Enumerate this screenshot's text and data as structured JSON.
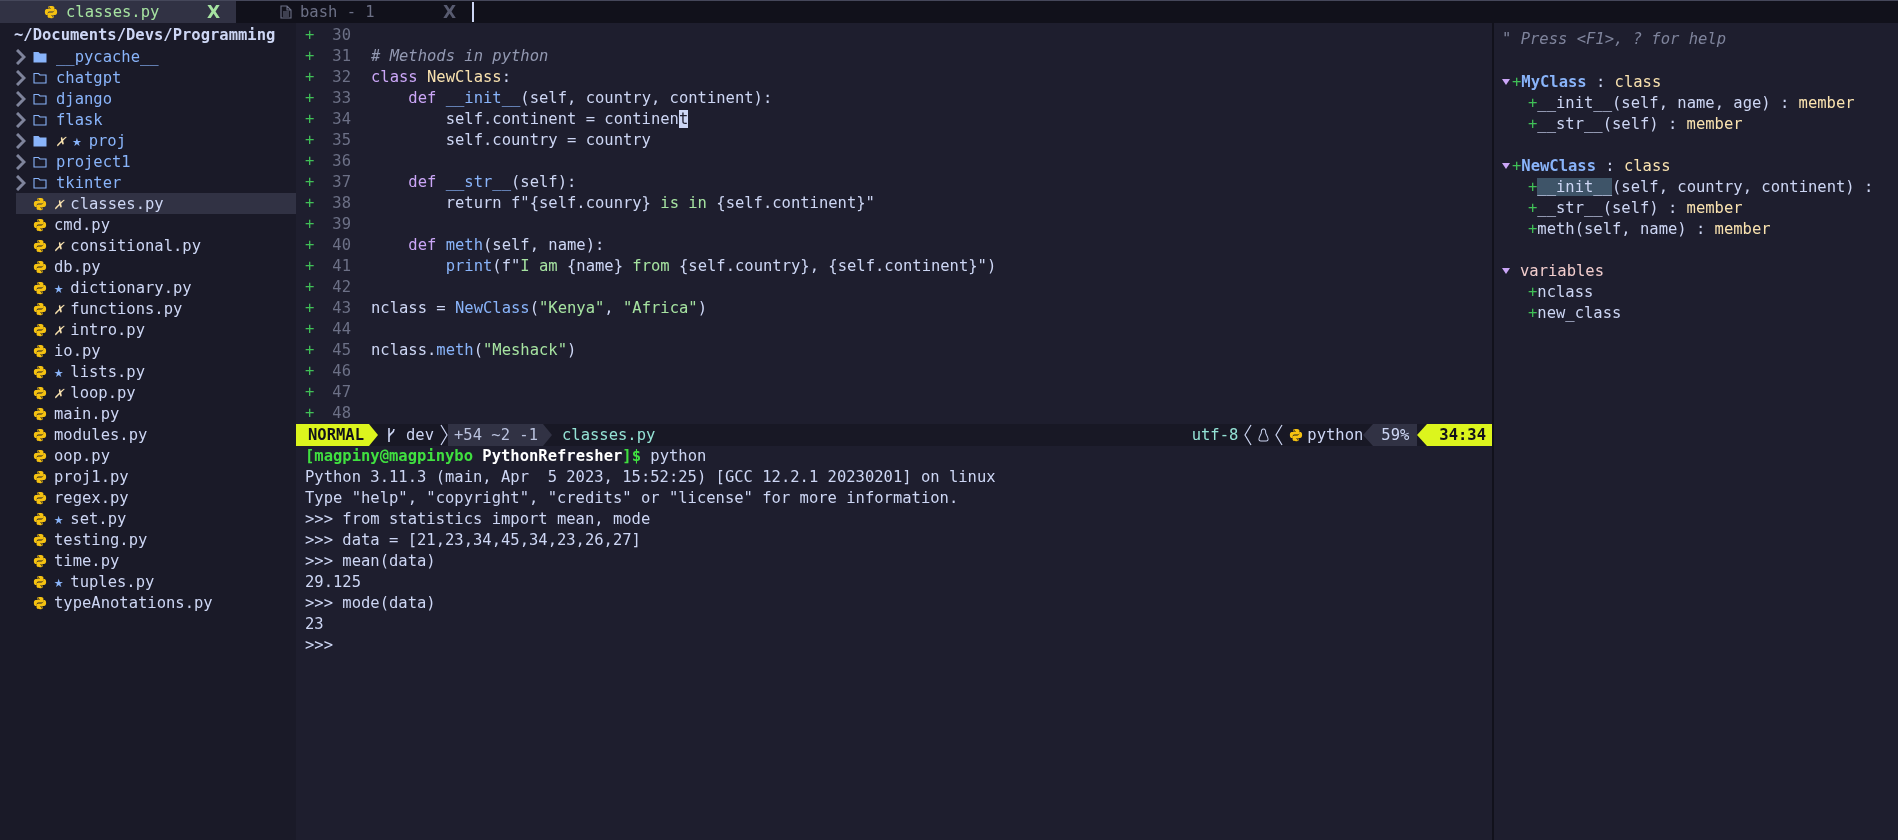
{
  "tabs": [
    {
      "kind": "python",
      "label": "classes.py",
      "close": "X",
      "selected": true
    },
    {
      "kind": "document",
      "label": "bash - 1",
      "close": "X",
      "selected": false
    }
  ],
  "sidebar": {
    "path": "~/Documents/Devs/Programming",
    "items": [
      {
        "kind": "folder_solid",
        "name": "__pycache__",
        "selected": false
      },
      {
        "kind": "folder",
        "name": "chatgpt",
        "selected": false
      },
      {
        "kind": "folder",
        "name": "django",
        "selected": false
      },
      {
        "kind": "folder",
        "name": "flask",
        "selected": false
      },
      {
        "kind": "folder_solid",
        "name": "proj",
        "flags": [
          {
            "kind": "modified",
            "text": "✗"
          },
          {
            "kind": "new",
            "text": "★"
          }
        ],
        "selected": false
      },
      {
        "kind": "folder",
        "name": "project1",
        "selected": false
      },
      {
        "kind": "folder",
        "name": "tkinter",
        "selected": false
      },
      {
        "kind": "python",
        "name": "classes.py",
        "flags": [
          {
            "kind": "modified",
            "text": "✗"
          }
        ],
        "selected": true
      },
      {
        "kind": "python",
        "name": "cmd.py",
        "selected": false
      },
      {
        "kind": "python",
        "name": "consitional.py",
        "flags": [
          {
            "kind": "modified",
            "text": "✗"
          }
        ],
        "selected": false
      },
      {
        "kind": "python",
        "name": "db.py",
        "selected": false
      },
      {
        "kind": "python",
        "name": "dictionary.py",
        "flags": [
          {
            "kind": "new",
            "text": "★"
          }
        ],
        "selected": false
      },
      {
        "kind": "python",
        "name": "functions.py",
        "flags": [
          {
            "kind": "modified",
            "text": "✗"
          }
        ],
        "selected": false
      },
      {
        "kind": "python",
        "name": "intro.py",
        "flags": [
          {
            "kind": "modified",
            "text": "✗"
          }
        ],
        "selected": false
      },
      {
        "kind": "python",
        "name": "io.py",
        "selected": false
      },
      {
        "kind": "python",
        "name": "lists.py",
        "flags": [
          {
            "kind": "new",
            "text": "★"
          }
        ],
        "selected": false
      },
      {
        "kind": "python",
        "name": "loop.py",
        "flags": [
          {
            "kind": "modified",
            "text": "✗"
          }
        ],
        "selected": false
      },
      {
        "kind": "python",
        "name": "main.py",
        "selected": false
      },
      {
        "kind": "python",
        "name": "modules.py",
        "selected": false
      },
      {
        "kind": "python",
        "name": "oop.py",
        "selected": false
      },
      {
        "kind": "python",
        "name": "proj1.py",
        "selected": false
      },
      {
        "kind": "python",
        "name": "regex.py",
        "selected": false
      },
      {
        "kind": "python",
        "name": "set.py",
        "flags": [
          {
            "kind": "new",
            "text": "★"
          }
        ],
        "selected": false
      },
      {
        "kind": "python",
        "name": "testing.py",
        "selected": false
      },
      {
        "kind": "python",
        "name": "time.py",
        "selected": false
      },
      {
        "kind": "python",
        "name": "tuples.py",
        "flags": [
          {
            "kind": "new",
            "text": "★"
          }
        ],
        "selected": false
      },
      {
        "kind": "python",
        "name": "typeAnotations.py",
        "selected": false
      }
    ]
  },
  "editor": {
    "lines": [
      {
        "sign": "+",
        "number": "30"
      },
      {
        "sign": "+",
        "number": "31",
        "tokens": [
          {
            "kind": "comment",
            "text": "# Methods in python"
          }
        ]
      },
      {
        "sign": "+",
        "number": "32",
        "tokens": [
          {
            "kind": "keyword",
            "text": "class "
          },
          {
            "kind": "type",
            "text": "NewClass"
          },
          {
            "kind": "plain",
            "text": ":"
          }
        ]
      },
      {
        "sign": "+",
        "number": "33",
        "tokens": [
          {
            "kind": "keyword",
            "text": "    def "
          },
          {
            "kind": "func",
            "text": "__init__"
          },
          {
            "kind": "plain",
            "text": "(self, country, continent):"
          }
        ]
      },
      {
        "sign": "+",
        "number": "34",
        "tokens": [
          {
            "kind": "plain",
            "text": "        self.continent = continen"
          },
          {
            "kind": "cursor",
            "text": "t"
          }
        ]
      },
      {
        "sign": "+",
        "number": "35",
        "tokens": [
          {
            "kind": "plain",
            "text": "        self.country = country"
          }
        ]
      },
      {
        "sign": "+",
        "number": "36"
      },
      {
        "sign": "+",
        "number": "37",
        "tokens": [
          {
            "kind": "keyword",
            "text": "    def "
          },
          {
            "kind": "func",
            "text": "__str__"
          },
          {
            "kind": "plain",
            "text": "(self):"
          }
        ]
      },
      {
        "sign": "+",
        "number": "38",
        "tokens": [
          {
            "kind": "plain",
            "text": "        return f\"{self.counry} "
          },
          {
            "kind": "string",
            "text": "is in "
          },
          {
            "kind": "plain",
            "text": "{self.continent}\""
          }
        ]
      },
      {
        "sign": "+",
        "number": "39"
      },
      {
        "sign": "+",
        "number": "40",
        "tokens": [
          {
            "kind": "keyword",
            "text": "    def "
          },
          {
            "kind": "func",
            "text": "meth"
          },
          {
            "kind": "plain",
            "text": "(self, name):"
          }
        ]
      },
      {
        "sign": "+",
        "number": "41",
        "tokens": [
          {
            "kind": "func",
            "text": "        print"
          },
          {
            "kind": "plain",
            "text": "(f\""
          },
          {
            "kind": "string",
            "text": "I am "
          },
          {
            "kind": "plain",
            "text": "{name} "
          },
          {
            "kind": "string",
            "text": "from "
          },
          {
            "kind": "plain",
            "text": "{self.country}, {self.continent}\")"
          }
        ]
      },
      {
        "sign": "+",
        "number": "42"
      },
      {
        "sign": "+",
        "number": "43",
        "tokens": [
          {
            "kind": "plain",
            "text": "nclass = "
          },
          {
            "kind": "func",
            "text": "NewClass"
          },
          {
            "kind": "plain",
            "text": "("
          },
          {
            "kind": "string",
            "text": "\"Kenya\""
          },
          {
            "kind": "plain",
            "text": ", "
          },
          {
            "kind": "string",
            "text": "\"Africa\""
          },
          {
            "kind": "plain",
            "text": ")"
          }
        ]
      },
      {
        "sign": "+",
        "number": "44"
      },
      {
        "sign": "+",
        "number": "45",
        "tokens": [
          {
            "kind": "plain",
            "text": "nclass."
          },
          {
            "kind": "func",
            "text": "meth"
          },
          {
            "kind": "plain",
            "text": "("
          },
          {
            "kind": "string",
            "text": "\"Meshack\""
          },
          {
            "kind": "plain",
            "text": ")"
          }
        ]
      },
      {
        "sign": "+",
        "number": "46"
      },
      {
        "sign": "+",
        "number": "47"
      },
      {
        "sign": "+",
        "number": "48"
      }
    ]
  },
  "status_bar": {
    "mode": "NORMAL",
    "branch": "dev",
    "diff": "+54 ~2 -1",
    "file": "classes.py",
    "encoding": "utf-8",
    "filetype": "python",
    "percent": "59%",
    "position": "34:34"
  },
  "terminal": {
    "lines": [
      {
        "tokens": [
          {
            "kind": "prompt",
            "text": "[magpiny@magpinybo "
          },
          {
            "kind": "dir",
            "text": "PythonRefresher"
          },
          {
            "kind": "prompt",
            "text": "]$"
          },
          {
            "kind": "plain",
            "text": " python"
          }
        ]
      },
      {
        "tokens": [
          {
            "kind": "plain",
            "text": "Python 3.11.3 (main, Apr  5 2023, 15:52:25) [GCC 12.2.1 20230201] on linux"
          }
        ]
      },
      {
        "tokens": [
          {
            "kind": "plain",
            "text": "Type \"help\", \"copyright\", \"credits\" or \"license\" for more information."
          }
        ]
      },
      {
        "tokens": [
          {
            "kind": "plain",
            "text": ">>> from statistics import mean, mode"
          }
        ]
      },
      {
        "tokens": [
          {
            "kind": "plain",
            "text": ">>> data = [21,23,34,45,34,23,26,27]"
          }
        ]
      },
      {
        "tokens": [
          {
            "kind": "plain",
            "text": ">>> mean(data)"
          }
        ]
      },
      {
        "tokens": [
          {
            "kind": "plain",
            "text": "29.125"
          }
        ]
      },
      {
        "tokens": [
          {
            "kind": "plain",
            "text": ">>> mode(data)"
          }
        ]
      },
      {
        "tokens": [
          {
            "kind": "plain",
            "text": "23"
          }
        ]
      },
      {
        "tokens": [
          {
            "kind": "plain",
            "text": ">>>"
          }
        ]
      }
    ]
  },
  "tagbar": {
    "help": "\" Press <F1>, ? for help",
    "groups": [
      {
        "kind": "class",
        "expanded": true,
        "sign": "+",
        "name": "MyClass",
        "sep": ":",
        "type": "class",
        "members": [
          {
            "sign": "+",
            "name": "__init__",
            "args": "(self, name, age)",
            "sep": ":",
            "type": "member",
            "highlighted": false
          },
          {
            "sign": "+",
            "name": "__str__",
            "args": "(self)",
            "sep": ":",
            "type": "member",
            "highlighted": false
          }
        ]
      },
      {
        "kind": "class",
        "expanded": true,
        "sign": "+",
        "name": "NewClass",
        "sep": ":",
        "type": "class",
        "members": [
          {
            "sign": "+",
            "name": "__init__",
            "args": "(self, country, continent)",
            "sep": ":",
            "highlighted": true
          },
          {
            "sign": "+",
            "name": "__str__",
            "args": "(self)",
            "sep": ":",
            "type": "member",
            "highlighted": false
          },
          {
            "sign": "+",
            "name": "meth",
            "args": "(self, name)",
            "sep": ":",
            "type": "member",
            "highlighted": false
          }
        ]
      },
      {
        "kind": "section",
        "expanded": true,
        "name": "variables",
        "members": [
          {
            "sign": "+",
            "name": "nclass",
            "highlighted": false
          },
          {
            "sign": "+",
            "name": "new_class",
            "highlighted": false
          }
        ]
      }
    ]
  }
}
